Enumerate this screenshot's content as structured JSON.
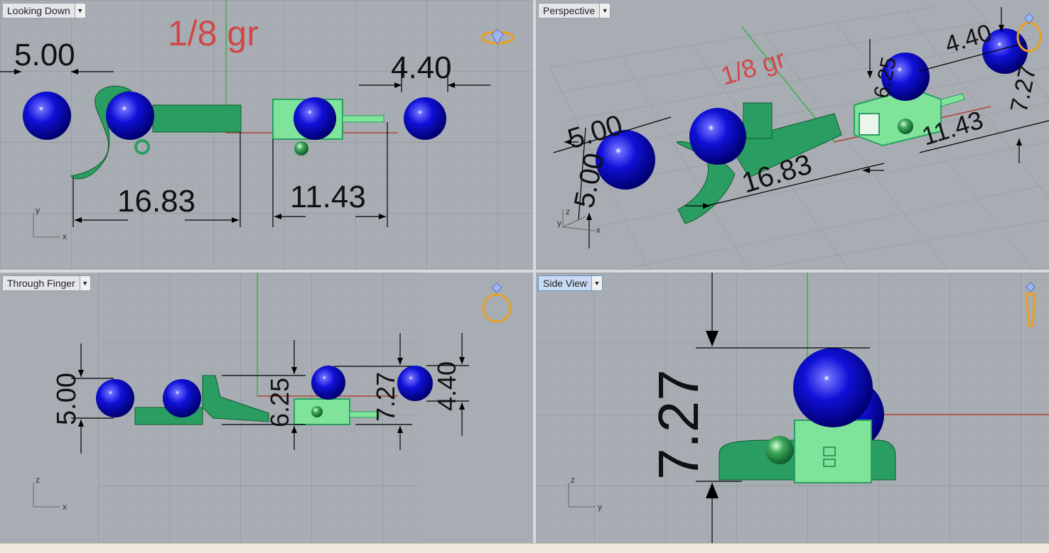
{
  "viewports": {
    "top": {
      "label": "Looking Down"
    },
    "perspective": {
      "label": "Perspective"
    },
    "front": {
      "label": "Through Finger"
    },
    "side": {
      "label": "Side View"
    }
  },
  "annotations": {
    "weight": "1/8 gr"
  },
  "dimensions": {
    "top": [
      "5.00",
      "4.40",
      "16.83",
      "11.43"
    ],
    "perspective": [
      "5.00",
      "5.00",
      "16.83",
      "11.43",
      "4.40",
      "7.27",
      "6.25"
    ],
    "front": [
      "5.00",
      "6.25",
      "7.27",
      "4.40"
    ],
    "side": [
      "7.27"
    ]
  },
  "axes": {
    "top": [
      "y",
      "x"
    ],
    "perspective": [
      "z",
      "y",
      "x"
    ],
    "front": [
      "z",
      "x"
    ],
    "side": [
      "z",
      "y"
    ]
  },
  "icons": {
    "top": "ring-top-icon",
    "perspective": "ring-perspective-icon",
    "front": "ring-front-icon",
    "side": "ring-side-icon"
  },
  "colors": {
    "viewport_bg": "#a8adb4",
    "grid": "#959aa1",
    "sphere": "#0a0ad0",
    "part_green": "#2a9e62",
    "part_light_green": "#7fe39a",
    "x_axis": "#b0443a",
    "y_axis": "#3bb04a",
    "weight_text": "#d04848",
    "ring_icon": "#e8a020"
  }
}
